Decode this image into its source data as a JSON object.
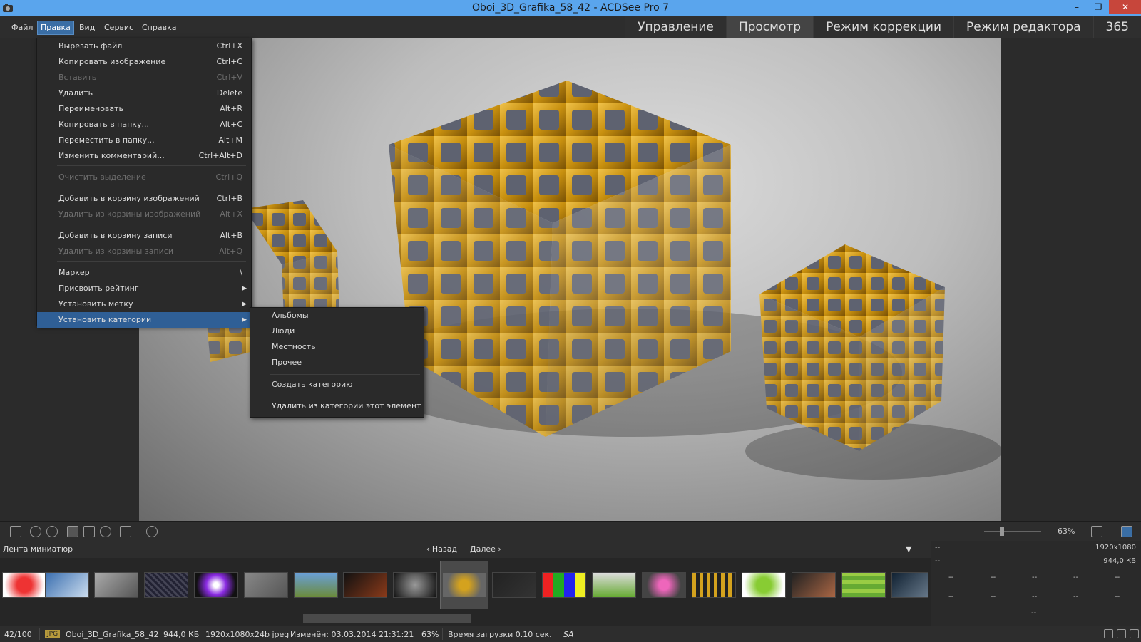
{
  "window": {
    "title": "Oboi_3D_Grafika_58_42 - ACDSee Pro 7",
    "minimize": "–",
    "restore": "❐",
    "close": "✕"
  },
  "menubar": [
    "Файл",
    "Правка",
    "Вид",
    "Сервис",
    "Справка"
  ],
  "modes": [
    "Управление",
    "Просмотр",
    "Режим коррекции",
    "Режим редактора",
    "365"
  ],
  "edit_menu": {
    "items": [
      {
        "label": "Вырезать файл",
        "shortcut": "Ctrl+X"
      },
      {
        "label": "Копировать изображение",
        "shortcut": "Ctrl+C"
      },
      {
        "label": "Вставить",
        "shortcut": "Ctrl+V"
      },
      {
        "label": "Удалить",
        "shortcut": "Delete"
      },
      {
        "label": "Переименовать",
        "shortcut": "Alt+R"
      },
      {
        "label": "Копировать в папку...",
        "shortcut": "Alt+C"
      },
      {
        "label": "Переместить в папку...",
        "shortcut": "Alt+M"
      },
      {
        "label": "Изменить комментарий...",
        "shortcut": "Ctrl+Alt+D"
      },
      {
        "label": "Очистить выделение",
        "shortcut": "Ctrl+Q"
      },
      {
        "label": "Добавить в корзину изображений",
        "shortcut": "Ctrl+B"
      },
      {
        "label": "Удалить из корзины изображений",
        "shortcut": "Alt+X"
      },
      {
        "label": "Добавить в корзину записи",
        "shortcut": "Alt+B"
      },
      {
        "label": "Удалить из корзины записи",
        "shortcut": "Alt+Q"
      },
      {
        "label": "Маркер",
        "shortcut": "\\"
      },
      {
        "label": "Присвоить рейтинг",
        "shortcut": ""
      },
      {
        "label": "Установить метку",
        "shortcut": ""
      },
      {
        "label": "Установить категории",
        "shortcut": ""
      }
    ]
  },
  "categories_submenu": [
    "Альбомы",
    "Люди",
    "Местность",
    "Прочее",
    "Создать категорию",
    "Удалить из категории этот элемент"
  ],
  "filmstrip": {
    "title": "Лента миниатюр",
    "back": "Назад",
    "next": "Далее"
  },
  "zoom": "63%",
  "info_panel": {
    "dims": "1920x1080",
    "size": "944,0 КБ",
    "dash": "--"
  },
  "status": {
    "index": "42/100",
    "format_badge": "JPG",
    "filename": "Oboi_3D_Grafika_58_42",
    "filesize": "944,0 КБ",
    "dims_type": "1920x1080x24b jpeg",
    "modified": "Изменён: 03.03.2014 21:31:21",
    "zoom": "63%",
    "load_time": "Время загрузки 0.10 сек.",
    "sa": "SA"
  },
  "colors": {
    "titlebar": "#5aa5ed",
    "highlight": "#2f5f96",
    "gold": "#d4a21e"
  }
}
